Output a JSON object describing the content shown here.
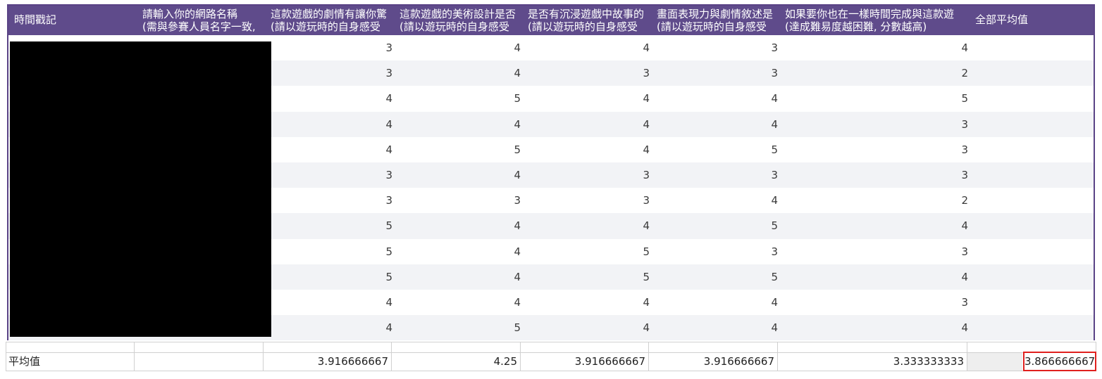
{
  "header": {
    "col_timestamp": "時間戳記",
    "col_name_l1": "請輸入你的網路名稱",
    "col_name_l2": "(需與參賽人員名字一致,",
    "col_q1_l1": "這款遊戲的劇情有讓你驚",
    "col_q1_l2": "(請以遊玩時的自身感受",
    "col_q2_l1": "這款遊戲的美術設計是否",
    "col_q2_l2": "(請以遊玩時的自身感受",
    "col_q3_l1": "是否有沉浸遊戲中故事的",
    "col_q3_l2": "(請以遊玩時的自身感受",
    "col_q4_l1": "畫面表現力與劇情敘述是",
    "col_q4_l2": "(請以遊玩時的自身感受",
    "col_q5_l1": "如果要你也在一樣時間完成與這款遊",
    "col_q5_l2": "(達成難易度越困難, 分數越高)",
    "col_avg": "全部平均值"
  },
  "rows": [
    [
      "3",
      "4",
      "4",
      "3",
      "4"
    ],
    [
      "3",
      "4",
      "3",
      "3",
      "2"
    ],
    [
      "4",
      "5",
      "4",
      "4",
      "5"
    ],
    [
      "4",
      "4",
      "4",
      "4",
      "3"
    ],
    [
      "4",
      "5",
      "4",
      "5",
      "3"
    ],
    [
      "3",
      "4",
      "3",
      "3",
      "3"
    ],
    [
      "3",
      "3",
      "3",
      "4",
      "2"
    ],
    [
      "5",
      "4",
      "4",
      "5",
      "4"
    ],
    [
      "5",
      "4",
      "5",
      "3",
      "3"
    ],
    [
      "5",
      "4",
      "5",
      "5",
      "4"
    ],
    [
      "4",
      "4",
      "4",
      "4",
      "3"
    ],
    [
      "4",
      "5",
      "4",
      "4",
      "4"
    ]
  ],
  "footer": {
    "label": "平均值",
    "q1": "3.916666667",
    "q2": "4.25",
    "q3": "3.916666667",
    "q4": "3.916666667",
    "q5": "3.333333333",
    "overall": "3.866666667"
  },
  "colors": {
    "header_bg": "#5f4b8b",
    "frame_border": "#5a4386",
    "alt_row": "#f2f3f6",
    "highlight_border": "#e0201e"
  }
}
